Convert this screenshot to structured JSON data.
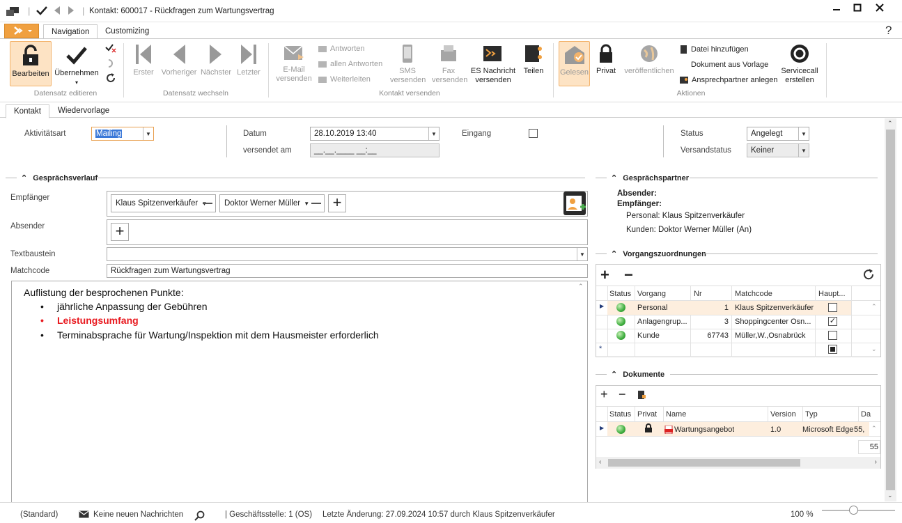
{
  "window": {
    "title": "Kontakt: 600017 - Rückfragen zum Wartungsvertrag",
    "help": "?"
  },
  "ribbon_tabs": [
    "Navigation",
    "Customizing"
  ],
  "ribbon": {
    "bearbeiten": "Bearbeiten",
    "uebernehmen": "Übernehmen",
    "erster": "Erster",
    "vorheriger": "Vorheriger",
    "naechster": "Nächster",
    "letzter": "Letzter",
    "email": "E-Mail versenden",
    "antworten": "Antworten",
    "allen_antworten": "allen Antworten",
    "weiterleiten": "Weiterleiten",
    "sms": "SMS versenden",
    "fax": "Fax versenden",
    "es_nachricht": "ES Nachricht versenden",
    "teilen": "Teilen",
    "gelesen": "Gelesen",
    "privat": "Privat",
    "veroeffentlichen": "veröffentlichen",
    "datei_hinzufuegen": "Datei hinzufügen",
    "dokument_vorlage": "Dokument aus Vorlage",
    "ansprechpartner": "Ansprechpartner anlegen",
    "servicecall": "Servicecall erstellen",
    "groups": {
      "datensatz_editieren": "Datensatz editieren",
      "datensatz_wechseln": "Datensatz wechseln",
      "kontakt_versenden": "Kontakt versenden",
      "aktionen": "Aktionen"
    }
  },
  "tabs": [
    "Kontakt",
    "Wiedervorlage"
  ],
  "form": {
    "aktivitaetsart_label": "Aktivitätsart",
    "aktivitaetsart": "Mailing",
    "datum_label": "Datum",
    "datum": "28.10.2019 13:40",
    "versendet_label": "versendet am",
    "versendet": "__.__.____ __:__",
    "eingang_label": "Eingang",
    "status_label": "Status",
    "status": "Angelegt",
    "versandstatus_label": "Versandstatus",
    "versandstatus": "Keiner"
  },
  "verlauf": {
    "section": "Gesprächsverlauf",
    "empfaenger_label": "Empfänger",
    "empfaenger": [
      "Klaus Spitzenverkäufer",
      "Doktor Werner Müller"
    ],
    "absender_label": "Absender",
    "textbaustein_label": "Textbaustein",
    "matchcode_label": "Matchcode",
    "matchcode": "Rückfragen zum Wartungsvertrag"
  },
  "editor": {
    "heading": "Auflistung der besprochenen Punkte:",
    "items": [
      "jährliche Anpassung der Gebühren",
      "Leistungsumfang",
      "Terminabsprache für Wartung/Inspektion mit dem Hausmeister erforderlich"
    ],
    "highlight_color": "#e8191f"
  },
  "partner": {
    "section": "Gesprächspartner",
    "absender_label": "Absender:",
    "empfaenger_label": "Empfänger:",
    "personal": "Personal: Klaus Spitzenverkäufer",
    "kunden": "Kunden: Doktor Werner Müller (An)"
  },
  "vorgang": {
    "section": "Vorgangszuordnungen",
    "columns": [
      "Status",
      "Vorgang",
      "Nr",
      "Matchcode",
      "Haupt..."
    ],
    "rows": [
      {
        "vorgang": "Personal",
        "nr": "1",
        "matchcode": "Klaus Spitzenverkäufer",
        "haupt": false
      },
      {
        "vorgang": "Anlagengrup...",
        "nr": "3",
        "matchcode": "Shoppingcenter Osn...",
        "haupt": true
      },
      {
        "vorgang": "Kunde",
        "nr": "67743",
        "matchcode": "Müller,W.,Osnabrück",
        "haupt": false
      }
    ]
  },
  "dokumente": {
    "section": "Dokumente",
    "columns": [
      "Status",
      "Privat",
      "Name",
      "Version",
      "Typ",
      "Da"
    ],
    "rows": [
      {
        "name": "Wartungsangebot",
        "version": "1.0",
        "typ": "Microsoft Edge",
        "da": "55,"
      }
    ],
    "footer": "55"
  },
  "statusbar": {
    "layout": "(Standard)",
    "nachrichten": "Keine neuen Nachrichten",
    "geschaeftsstelle": "| Geschäftsstelle:  1 (OS)",
    "letzte_aenderung": "Letzte Änderung: 27.09.2024 10:57 durch Klaus Spitzenverkäufer",
    "zoom": "100 %"
  },
  "colors": {
    "accent": "#f0a040",
    "selected_bg": "#fde3c4",
    "row_highlight": "#fdeede"
  }
}
